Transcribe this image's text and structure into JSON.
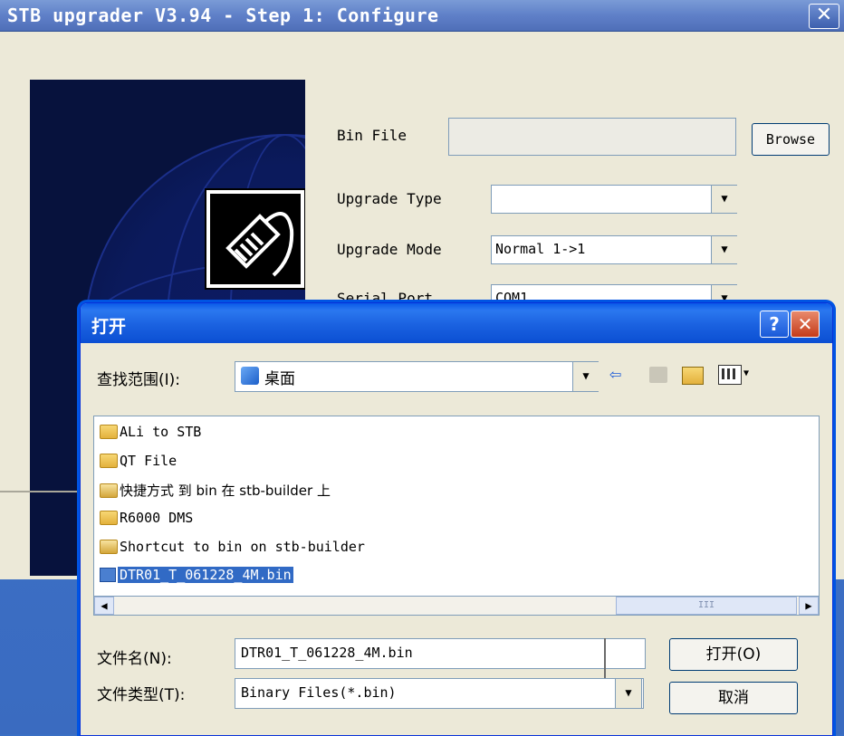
{
  "upgrader": {
    "title": "STB upgrader V3.94 - Step 1: Configure",
    "close_glyph": "✕",
    "bin_file_label": "Bin File",
    "bin_file_value": "",
    "browse_label": "Browse",
    "upgrade_type_label": "Upgrade Type",
    "upgrade_type_value": "",
    "upgrade_mode_label": "Upgrade Mode",
    "upgrade_mode_value": "Normal 1->1",
    "serial_port_label": "Serial Port",
    "serial_port_value": "COM1"
  },
  "dialog": {
    "title": "打开",
    "help_glyph": "?",
    "close_glyph": "✕",
    "look_in_label": "查找范围(I):",
    "look_in_value": "桌面",
    "files": [
      {
        "name": "ALi to STB",
        "type": "folder-shortcut"
      },
      {
        "name": "QT File",
        "type": "folder-shortcut"
      },
      {
        "name": "快捷方式 到 bin 在 stb-builder 上",
        "type": "network-shortcut"
      },
      {
        "name": "R6000 DMS",
        "type": "folder-shortcut"
      },
      {
        "name": "Shortcut to bin on stb-builder",
        "type": "network-shortcut"
      },
      {
        "name": "DTR01_T_061228_4M.bin",
        "type": "file",
        "selected": true
      }
    ],
    "scroll_thumb_glyph": "III",
    "filename_label": "文件名(N):",
    "filename_value": "DTR01_T_061228_4M.bin",
    "filetype_label": "文件类型(T):",
    "filetype_value": "Binary Files(*.bin)",
    "open_button": "打开(O)",
    "cancel_button": "取消"
  },
  "colors": {
    "selected_bg": "#316ac5",
    "title_blue": "#0b4fd3",
    "banner_navy": "#07123d"
  }
}
